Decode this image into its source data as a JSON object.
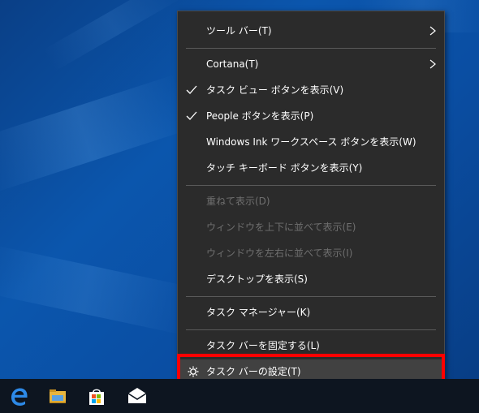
{
  "menu": {
    "items": {
      "toolbars": "ツール バー(T)",
      "cortana": "Cortana(T)",
      "task_view": "タスク ビュー ボタンを表示(V)",
      "people": "People ボタンを表示(P)",
      "windows_ink": "Windows Ink ワークスペース ボタンを表示(W)",
      "touch_keyboard": "タッチ キーボード ボタンを表示(Y)",
      "cascade": "重ねて表示(D)",
      "stack": "ウィンドウを上下に並べて表示(E)",
      "side_by_side": "ウィンドウを左右に並べて表示(I)",
      "show_desktop": "デスクトップを表示(S)",
      "task_manager": "タスク マネージャー(K)",
      "lock_taskbar": "タスク バーを固定する(L)",
      "taskbar_settings": "タスク バーの設定(T)"
    }
  },
  "colors": {
    "menu_bg": "#2b2b2b",
    "highlight": "#ff0000",
    "taskbar_bg": "#0d1520",
    "disabled_text": "#6f6f6f"
  },
  "taskbar": {
    "icons": [
      "edge-icon",
      "file-explorer-icon",
      "store-icon",
      "mail-icon"
    ]
  }
}
